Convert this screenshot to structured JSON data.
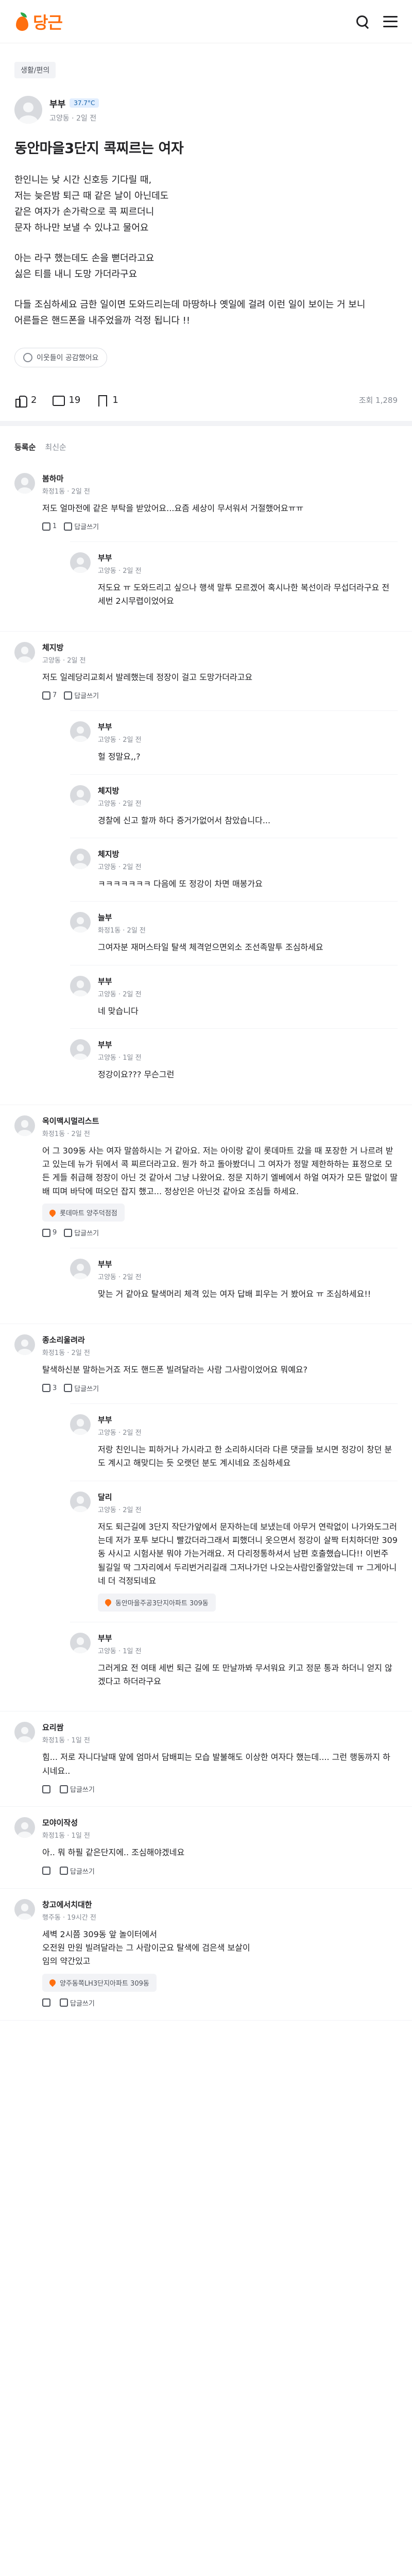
{
  "app": {
    "logo_text": "당근",
    "brand_color": "#ff6f0f"
  },
  "post": {
    "category": "생활/편의",
    "author": {
      "name": "부부",
      "temp": "37.7°C",
      "neighborhood": "고양동",
      "time": "2일 전"
    },
    "title": "동안마을3단지 콕찌르는 여자",
    "paragraphs": [
      "한인니는 낮 시간 신호등 기다릴 때,\n저는 늦은밤 퇴근 때 같은 날이 아닌데도\n같은 여자가 손가락으로 콕 찌르더니\n문자 하나만 보낼 수 있냐고 물어요",
      "아는 라구 했는데도 손을 뻗더라고요\n싫은 티를 내니 도망 가더라구요",
      "다들 조심하세요 금한 일이면 도와드리는데 마땅하나 옛일에 걸려 이런 일이 보이는 거 보니\n어른들은 핸드폰을 내주었을까 걱정 됩니다 !!"
    ],
    "curious_label": "이웃들이 공감했어요",
    "likes": "2",
    "comments": "19",
    "bookmarks": "1",
    "views": "조회 1,289"
  },
  "comment_section": {
    "title": "등록순",
    "alt_sort": "최신순"
  },
  "comments": [
    {
      "name": "봄하마",
      "meta": "화정1동 · 2일 전",
      "text": "저도 얼마전에 같은 부탁을 받았어요...요즘 세상이 무서워서 거절했어요ㅠㅠ",
      "likes": "1",
      "reply_label": "답글쓰기",
      "replies": [
        {
          "name": "부부",
          "meta": "고양동 · 2일 전",
          "text": "저도요 ㅠ 도와드리고 싶으나 행색 말투 모르겠어 혹시나한 복선이라 무섭더라구요 전 세번 2시무렵이었어요"
        }
      ]
    },
    {
      "name": "체지방",
      "meta": "고양동 · 2일 전",
      "text": "저도 일레당리교회서 발레했는데 정장이 걸고 도망가더라고요",
      "likes": "7",
      "reply_label": "답글쓰기",
      "replies": [
        {
          "name": "부부",
          "meta": "고양동 · 2일 전",
          "text": "헐 정말요,,?"
        },
        {
          "name": "체지방",
          "meta": "고양동 · 2일 전",
          "text": "경찰에 신고 할까 하다 증거가없어서 참았습니다..."
        },
        {
          "name": "체지방",
          "meta": "고양동 · 2일 전",
          "text": "ㅋㅋㅋㅋㅋㅋㅋ 다음에 또 정강이 차면 매봉가요"
        },
        {
          "name": "늘부",
          "meta": "화정1동 · 2일 전",
          "text": "그여자분 재머스타일 탈색 체격얻으면외소 조선족말투 조심하세요"
        },
        {
          "name": "부부",
          "meta": "고양동 · 2일 전",
          "text": "네 맞습니다"
        },
        {
          "name": "부부",
          "meta": "고양동 · 1일 전",
          "text": "정강이요??? 무슨그런"
        }
      ]
    },
    {
      "name": "옥이맥시멀리스트",
      "meta": "화정1동 · 2일 전",
      "text": "어 그 309동 사는 여자 말씀하시는 거 같아요. 저는 아이랑 같이 롯데마트 갔을 때 포장한 거 나르려 받고 있는데 뉴가 뒤에서 콕 찌르더라고요. 뭔가 하고 돌아봤더니 그 여자가 정말 제한하하는 표정으로 모든 게들 취급해 정장이 아닌 것 같아서 그냥 나왔어요. 정문 지하기 엘베에서 하얼 여자가 모든 말없이 딸배 띠며 바닥에 떠오던 잡지 했고... 정상인은 아닌것 같아요 조심들 하세요.",
      "location": "롯데마트 양주덕점점",
      "likes": "9",
      "reply_label": "답글쓰기",
      "replies": [
        {
          "name": "부부",
          "meta": "고양동 · 2일 전",
          "text": "맞는 거 같아요 탈색머리 체격 있는 여자 답배 피우는 거 봤어요 ㅠ 조심하세요!!"
        }
      ]
    },
    {
      "name": "종소리울려라",
      "meta": "화정1동 · 2일 전",
      "text": "탈색하신분 말하는거죠 저도 핸드폰 빌려달라는 사람 그사람이었어요 뭐예요?",
      "likes": "3",
      "reply_label": "답글쓰기",
      "replies": [
        {
          "name": "부부",
          "meta": "고양동 · 2일 전",
          "text": "저랑 친인니는 피하거나 가시라고 한 소리하시더라 다른 댓글들 보시면 정강이 창던 분도 계시고 해맞디는 듯 오랫던 분도 계시네요 조심하세요"
        },
        {
          "name": "달리",
          "meta": "고양동 · 2일 전",
          "text": "저도 퇴근길에 3단지 작단가앞에서 문자하는데 보냈는데 아무거 연락없이 나가와도그러는데 저가 포투 보다니 빨갔더라그래서 피했더니 옷으면서 정강이 살짝 터치하더만 309동 사시고 시험사분 뭐야 가는거래요. 저 다리정통하셔서 남편 호출했습니다!! 이번주 될길일 딱 그자리에서 두리번거리길래 그저나가던 나오는사람인줄알았는데 ㅠ 그게아니네 더 걱정되네요",
          "location": "동안마을주공3단지아파트 309동"
        },
        {
          "name": "부부",
          "meta": "고양동 · 1일 전",
          "text": "그러게요 전 여태 세번 퇴근 길에 또 만날까봐 무서워요 키고 정문 통과 하더니 얻지 않겠다고 하더라구요"
        }
      ]
    },
    {
      "name": "요리쌈",
      "meta": "화정1동 · 1일 전",
      "text": "힘... 저로 자니다날때 앞에 엄마서 담배피는 모습 발불해도 이상한 여자다 했는데.... 그런 행동까지 하시네요..",
      "likes": "",
      "reply_label": "답글쓰기",
      "replies": []
    },
    {
      "name": "모야이작성",
      "meta": "화정1동 · 1일 전",
      "text": "아.. 뭐 하필 같은단지에.. 조심해야겠네요",
      "likes": "",
      "reply_label": "답글쓰기",
      "replies": []
    },
    {
      "name": "창고에서치대한",
      "meta": "행주동 · 19시간 전",
      "text": "세벽 2시쯤 309동 앞 놀이터에서\n오전원 만원 빌려달라는 그 사람이군요 탈색에 검은색 보살이\n임의 약간있고",
      "location": "양주동쪽LH3단지아파트 309동",
      "likes": "",
      "reply_label": "답글쓰기",
      "replies": []
    }
  ]
}
